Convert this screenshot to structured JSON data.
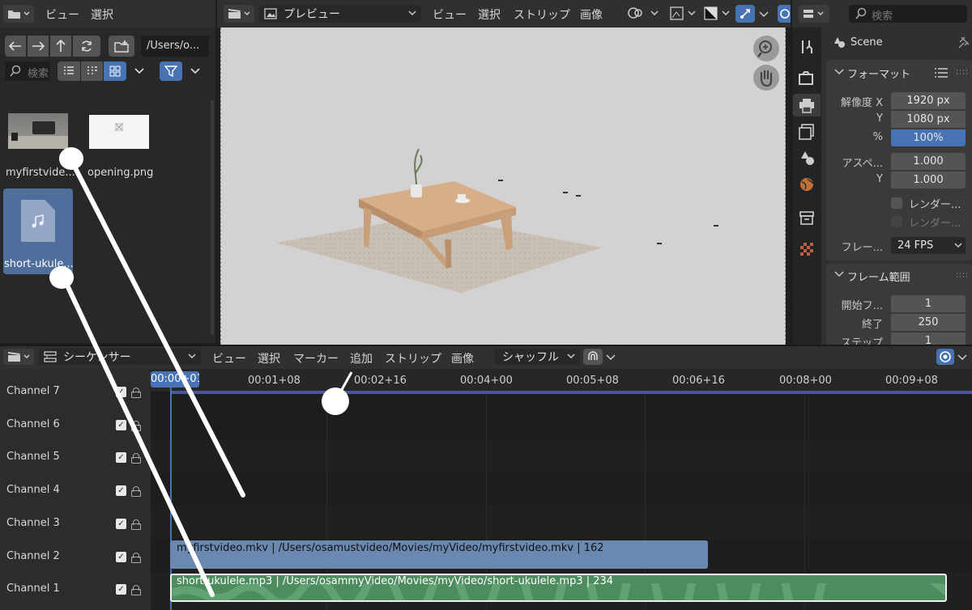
{
  "browser": {
    "menu": [
      "ビュー",
      "選択"
    ],
    "path": "/Users/o...",
    "search_placeholder": "検索",
    "files": [
      {
        "name": "myfirstvide..."
      },
      {
        "name": "opening.png"
      },
      {
        "name": "short-ukule..."
      }
    ]
  },
  "preview": {
    "mode": "プレビュー",
    "menu": [
      "ビュー",
      "選択",
      "ストリップ",
      "画像"
    ]
  },
  "props": {
    "search_placeholder": "検索",
    "scene": "Scene",
    "format_panel": "フォーマット",
    "res_x_label": "解像度 X",
    "res_x": "1920 px",
    "res_y_label": "Y",
    "res_y": "1080 px",
    "pct_label": "%",
    "pct": "100%",
    "aspect_label": "アスペ...",
    "aspect_x": "1.000",
    "aspect_y_label": "Y",
    "aspect_y": "1.000",
    "render1": "レンダー...",
    "render2": "レンダー...",
    "fps_label": "フレー...",
    "fps": "24 FPS",
    "range_panel": "フレーム範囲",
    "start_label": "開始フ...",
    "start": "1",
    "end_label": "終了",
    "end": "250",
    "step_label": "ステップ",
    "step": "1"
  },
  "sequencer": {
    "mode": "シーケンサー",
    "menu": [
      "ビュー",
      "選択",
      "マーカー",
      "追加",
      "ストリップ",
      "画像"
    ],
    "snap": "シャッフル",
    "current_time": "00:00+01",
    "ticks": [
      "00:01+08",
      "00:02+16",
      "00:04+00",
      "00:05+08",
      "00:06+16",
      "00:08+00",
      "00:09+08"
    ],
    "channels": [
      "Channel 7",
      "Channel 6",
      "Channel 5",
      "Channel 4",
      "Channel 3",
      "Channel 2",
      "Channel 1"
    ],
    "strips": [
      {
        "label": "myfirstvideo.mkv | /Users/osamustvideo/Movies/myVideo/myfirstvideo.mkv | 162",
        "color": "#6a88b0"
      },
      {
        "label": "short-ukulele.mp3 | /Users/osammyVideo/Movies/myVideo/short-ukulele.mp3 | 234",
        "color": "#4d8c5e"
      }
    ]
  }
}
